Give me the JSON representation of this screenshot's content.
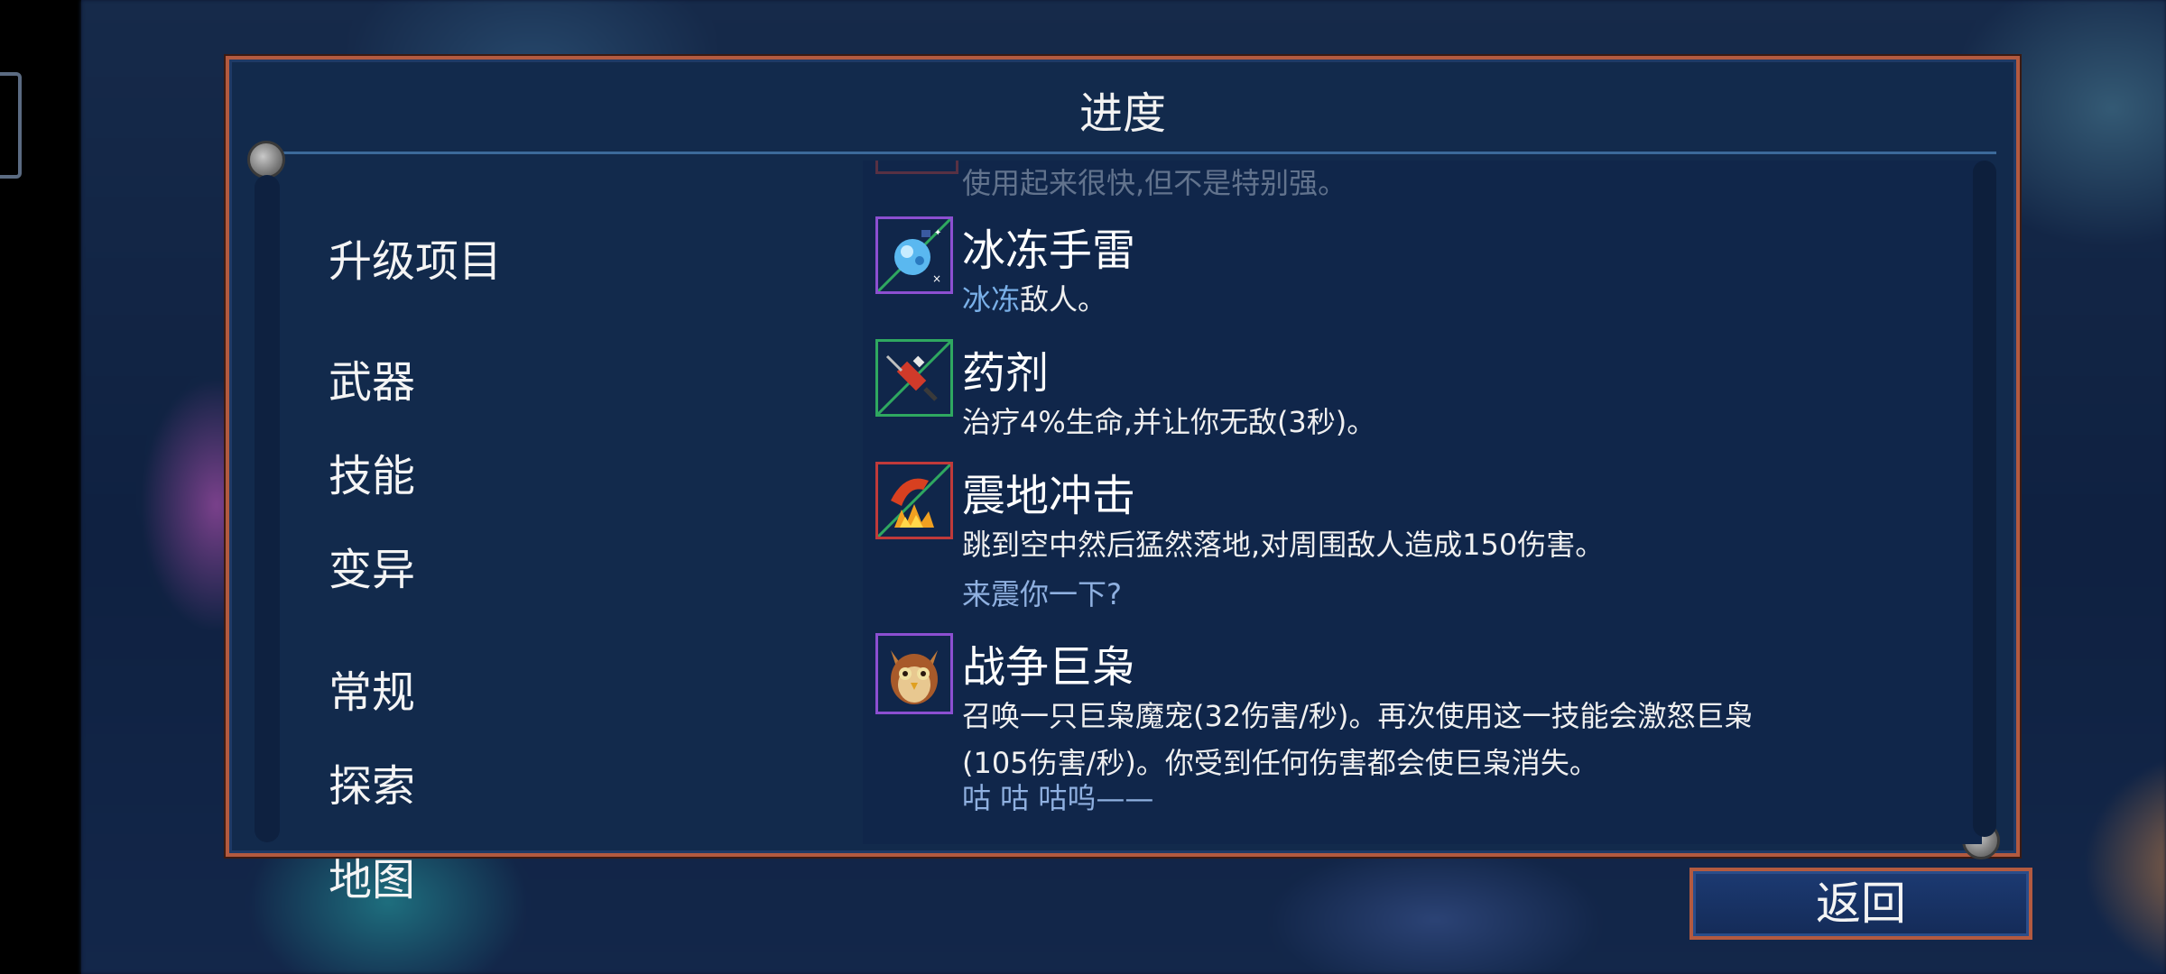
{
  "panel": {
    "title": "进度"
  },
  "nav": {
    "items": [
      {
        "label": "升级项目"
      },
      {
        "label": "武器"
      },
      {
        "label": "技能",
        "active": true
      },
      {
        "label": "变异"
      },
      {
        "label": "常规"
      },
      {
        "label": "探索"
      },
      {
        "label": "地图"
      }
    ]
  },
  "content": {
    "faded_prev_desc": "使用起来很快,但不是特别强。",
    "items": [
      {
        "name": "冰冻手雷",
        "desc_highlight": "冰冻",
        "desc_rest": "敌人。",
        "icon": "ice-grenade-icon"
      },
      {
        "name": "药剂",
        "desc": "治疗4%生命,并让你无敌(3秒)。",
        "icon": "syringe-icon"
      },
      {
        "name": "震地冲击",
        "desc": "跳到空中然后猛然落地,对周围敌人造成150伤害。",
        "quote": "来震你一下?",
        "icon": "ground-slam-icon"
      },
      {
        "name": "战争巨枭",
        "desc_line1": "召唤一只巨枭魔宠(32伤害/秒)。再次使用这一技能会激怒巨枭",
        "desc_line2": "(105伤害/秒)。你受到任何伤害都会使巨枭消失。",
        "quote": "咕 咕 咕呜——",
        "icon": "owl-icon"
      }
    ]
  },
  "footer": {
    "back_label": "返回"
  },
  "colors": {
    "panel_border": "#b35a40",
    "panel_bg": "#122a4c",
    "highlight": "#1f8ac4",
    "quote": "#8fb0e0"
  }
}
